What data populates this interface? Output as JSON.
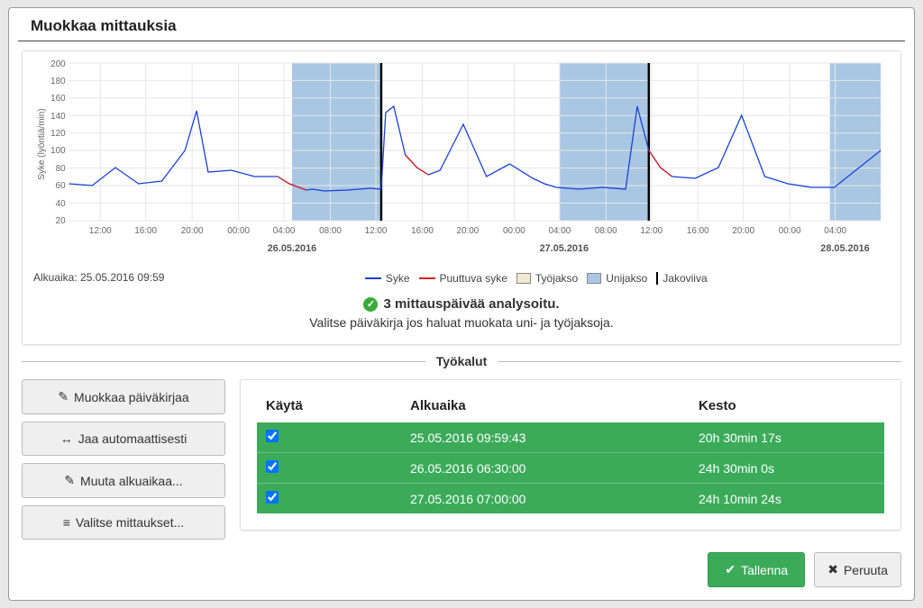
{
  "dialog": {
    "title": "Muokkaa mittauksia"
  },
  "chart": {
    "start_time_label": "Alkuaika: 25.05.2016 09:59",
    "yaxis_label": "Syke (lyöntiä/min)",
    "dates": {
      "d1": "26.05.2016",
      "d2": "27.05.2016",
      "d3": "28.05.2016"
    },
    "legend": {
      "hr": "Syke",
      "missing": "Puuttuva syke",
      "work": "Työjakso",
      "sleep": "Unijakso",
      "split": "Jakoviiva"
    }
  },
  "chart_data": {
    "type": "line",
    "ylabel": "Syke (lyöntiä/min)",
    "ylim": [
      20,
      200
    ],
    "y_ticks": [
      20,
      40,
      60,
      80,
      100,
      120,
      140,
      160,
      180,
      200
    ],
    "x_ticks": [
      "12:00",
      "16:00",
      "20:00",
      "00:00",
      "04:00",
      "08:00",
      "12:00",
      "16:00",
      "20:00",
      "00:00",
      "04:00",
      "08:00",
      "12:00",
      "16:00",
      "20:00",
      "00:00",
      "04:00"
    ],
    "sleep_bands": [
      {
        "start": "25.05 22:00",
        "end": "26.05 06:30"
      },
      {
        "start": "26.05 22:30",
        "end": "27.05 07:00"
      },
      {
        "start": "27.05 23:00",
        "end": "28.05 07:10"
      }
    ],
    "split_lines": [
      "26.05.2016 06:30:00",
      "27.05.2016 07:00:00"
    ],
    "series": [
      {
        "name": "Syke",
        "color": "#1840d8",
        "x": [
          0,
          2,
          4,
          6,
          8,
          10,
          11,
          12,
          14,
          16,
          18,
          19,
          20.5,
          21,
          22,
          24,
          26,
          28,
          29,
          30,
          31,
          32,
          34,
          36,
          38,
          40,
          42,
          43,
          44,
          46,
          48,
          50,
          51,
          52,
          53,
          54,
          56,
          58,
          60,
          62,
          64,
          66,
          68,
          70
        ],
        "y": [
          62,
          60,
          80,
          62,
          65,
          100,
          145,
          75,
          78,
          70,
          70,
          62,
          55,
          56,
          54,
          55,
          57,
          148,
          155,
          95,
          80,
          72,
          78,
          130,
          70,
          85,
          68,
          62,
          58,
          56,
          58,
          56,
          150,
          100,
          80,
          72,
          68,
          80,
          140,
          70,
          62,
          58,
          58,
          100
        ]
      },
      {
        "name": "Puuttuva syke",
        "color": "#d82020",
        "segments": [
          {
            "x": [
              18,
              19,
              20.5
            ],
            "y": [
              70,
              62,
              55
            ]
          },
          {
            "x": [
              30,
              31,
              32
            ],
            "y": [
              95,
              80,
              72
            ]
          },
          {
            "x": [
              52,
              53,
              54
            ],
            "y": [
              100,
              80,
              72
            ]
          }
        ]
      }
    ]
  },
  "status": {
    "headline": "3 mittauspäivää analysoitu.",
    "sub": "Valitse päiväkirja jos haluat muokata uni- ja työjaksoja."
  },
  "tools_label": "Työkalut",
  "buttons": {
    "edit_journal": "Muokkaa päiväkirjaa",
    "auto_split": "Jaa automaattisesti",
    "change_start": "Muuta alkuaikaa...",
    "select_measurements": "Valitse mittaukset..."
  },
  "table": {
    "headers": {
      "use": "Käytä",
      "start": "Alkuaika",
      "duration": "Kesto"
    },
    "rows": [
      {
        "checked": true,
        "start": "25.05.2016 09:59:43",
        "duration": "20h 30min 17s"
      },
      {
        "checked": true,
        "start": "26.05.2016 06:30:00",
        "duration": "24h 30min 0s"
      },
      {
        "checked": true,
        "start": "27.05.2016 07:00:00",
        "duration": "24h 10min 24s"
      }
    ]
  },
  "footer": {
    "save": "Tallenna",
    "cancel": "Peruuta"
  }
}
